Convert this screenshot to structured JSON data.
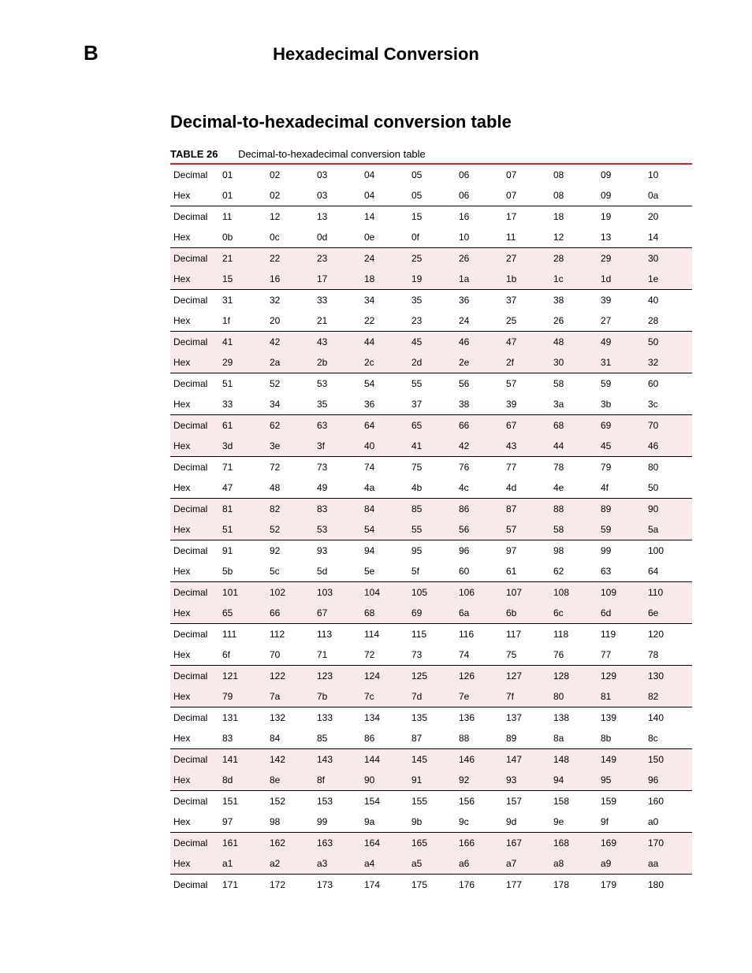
{
  "header": {
    "appendix_letter": "B",
    "page_title": "Hexadecimal Conversion"
  },
  "section": {
    "title": "Decimal-to-hexadecimal conversion table",
    "table_label": "TABLE 26",
    "table_caption": "Decimal-to-hexadecimal conversion table"
  },
  "labels": {
    "decimal": "Decimal",
    "hex": "Hex"
  },
  "groups": [
    {
      "shaded": false,
      "decimal": [
        "01",
        "02",
        "03",
        "04",
        "05",
        "06",
        "07",
        "08",
        "09",
        "10"
      ],
      "hex": [
        "01",
        "02",
        "03",
        "04",
        "05",
        "06",
        "07",
        "08",
        "09",
        "0a"
      ]
    },
    {
      "shaded": false,
      "decimal": [
        "11",
        "12",
        "13",
        "14",
        "15",
        "16",
        "17",
        "18",
        "19",
        "20"
      ],
      "hex": [
        "0b",
        "0c",
        "0d",
        "0e",
        "0f",
        "10",
        "11",
        "12",
        "13",
        "14"
      ]
    },
    {
      "shaded": true,
      "decimal": [
        "21",
        "22",
        "23",
        "24",
        "25",
        "26",
        "27",
        "28",
        "29",
        "30"
      ],
      "hex": [
        "15",
        "16",
        "17",
        "18",
        "19",
        "1a",
        "1b",
        "1c",
        "1d",
        "1e"
      ]
    },
    {
      "shaded": false,
      "decimal": [
        "31",
        "32",
        "33",
        "34",
        "35",
        "36",
        "37",
        "38",
        "39",
        "40"
      ],
      "hex": [
        "1f",
        "20",
        "21",
        "22",
        "23",
        "24",
        "25",
        "26",
        "27",
        "28"
      ]
    },
    {
      "shaded": true,
      "decimal": [
        "41",
        "42",
        "43",
        "44",
        "45",
        "46",
        "47",
        "48",
        "49",
        "50"
      ],
      "hex": [
        "29",
        "2a",
        "2b",
        "2c",
        "2d",
        "2e",
        "2f",
        "30",
        "31",
        "32"
      ]
    },
    {
      "shaded": false,
      "decimal": [
        "51",
        "52",
        "53",
        "54",
        "55",
        "56",
        "57",
        "58",
        "59",
        "60"
      ],
      "hex": [
        "33",
        "34",
        "35",
        "36",
        "37",
        "38",
        "39",
        "3a",
        "3b",
        "3c"
      ]
    },
    {
      "shaded": true,
      "decimal": [
        "61",
        "62",
        "63",
        "64",
        "65",
        "66",
        "67",
        "68",
        "69",
        "70"
      ],
      "hex": [
        "3d",
        "3e",
        "3f",
        "40",
        "41",
        "42",
        "43",
        "44",
        "45",
        "46"
      ]
    },
    {
      "shaded": false,
      "decimal": [
        "71",
        "72",
        "73",
        "74",
        "75",
        "76",
        "77",
        "78",
        "79",
        "80"
      ],
      "hex": [
        "47",
        "48",
        "49",
        "4a",
        "4b",
        "4c",
        "4d",
        "4e",
        "4f",
        "50"
      ]
    },
    {
      "shaded": true,
      "decimal": [
        "81",
        "82",
        "83",
        "84",
        "85",
        "86",
        "87",
        "88",
        "89",
        "90"
      ],
      "hex": [
        "51",
        "52",
        "53",
        "54",
        "55",
        "56",
        "57",
        "58",
        "59",
        "5a"
      ]
    },
    {
      "shaded": false,
      "decimal": [
        "91",
        "92",
        "93",
        "94",
        "95",
        "96",
        "97",
        "98",
        "99",
        "100"
      ],
      "hex": [
        "5b",
        "5c",
        "5d",
        "5e",
        "5f",
        "60",
        "61",
        "62",
        "63",
        "64"
      ]
    },
    {
      "shaded": true,
      "decimal": [
        "101",
        "102",
        "103",
        "104",
        "105",
        "106",
        "107",
        "108",
        "109",
        "110"
      ],
      "hex": [
        "65",
        "66",
        "67",
        "68",
        "69",
        "6a",
        "6b",
        "6c",
        "6d",
        "6e"
      ]
    },
    {
      "shaded": false,
      "decimal": [
        "111",
        "112",
        "113",
        "114",
        "115",
        "116",
        "117",
        "118",
        "119",
        "120"
      ],
      "hex": [
        "6f",
        "70",
        "71",
        "72",
        "73",
        "74",
        "75",
        "76",
        "77",
        "78"
      ]
    },
    {
      "shaded": true,
      "decimal": [
        "121",
        "122",
        "123",
        "124",
        "125",
        "126",
        "127",
        "128",
        "129",
        "130"
      ],
      "hex": [
        "79",
        "7a",
        "7b",
        "7c",
        "7d",
        "7e",
        "7f",
        "80",
        "81",
        "82"
      ]
    },
    {
      "shaded": false,
      "decimal": [
        "131",
        "132",
        "133",
        "134",
        "135",
        "136",
        "137",
        "138",
        "139",
        "140"
      ],
      "hex": [
        "83",
        "84",
        "85",
        "86",
        "87",
        "88",
        "89",
        "8a",
        "8b",
        "8c"
      ]
    },
    {
      "shaded": true,
      "decimal": [
        "141",
        "142",
        "143",
        "144",
        "145",
        "146",
        "147",
        "148",
        "149",
        "150"
      ],
      "hex": [
        "8d",
        "8e",
        "8f",
        "90",
        "91",
        "92",
        "93",
        "94",
        "95",
        "96"
      ]
    },
    {
      "shaded": false,
      "decimal": [
        "151",
        "152",
        "153",
        "154",
        "155",
        "156",
        "157",
        "158",
        "159",
        "160"
      ],
      "hex": [
        "97",
        "98",
        "99",
        "9a",
        "9b",
        "9c",
        "9d",
        "9e",
        "9f",
        "a0"
      ]
    },
    {
      "shaded": true,
      "decimal": [
        "161",
        "162",
        "163",
        "164",
        "165",
        "166",
        "167",
        "168",
        "169",
        "170"
      ],
      "hex": [
        "a1",
        "a2",
        "a3",
        "a4",
        "a5",
        "a6",
        "a7",
        "a8",
        "a9",
        "aa"
      ]
    },
    {
      "shaded": false,
      "decimal_only": true,
      "decimal": [
        "171",
        "172",
        "173",
        "174",
        "175",
        "176",
        "177",
        "178",
        "179",
        "180"
      ]
    }
  ]
}
